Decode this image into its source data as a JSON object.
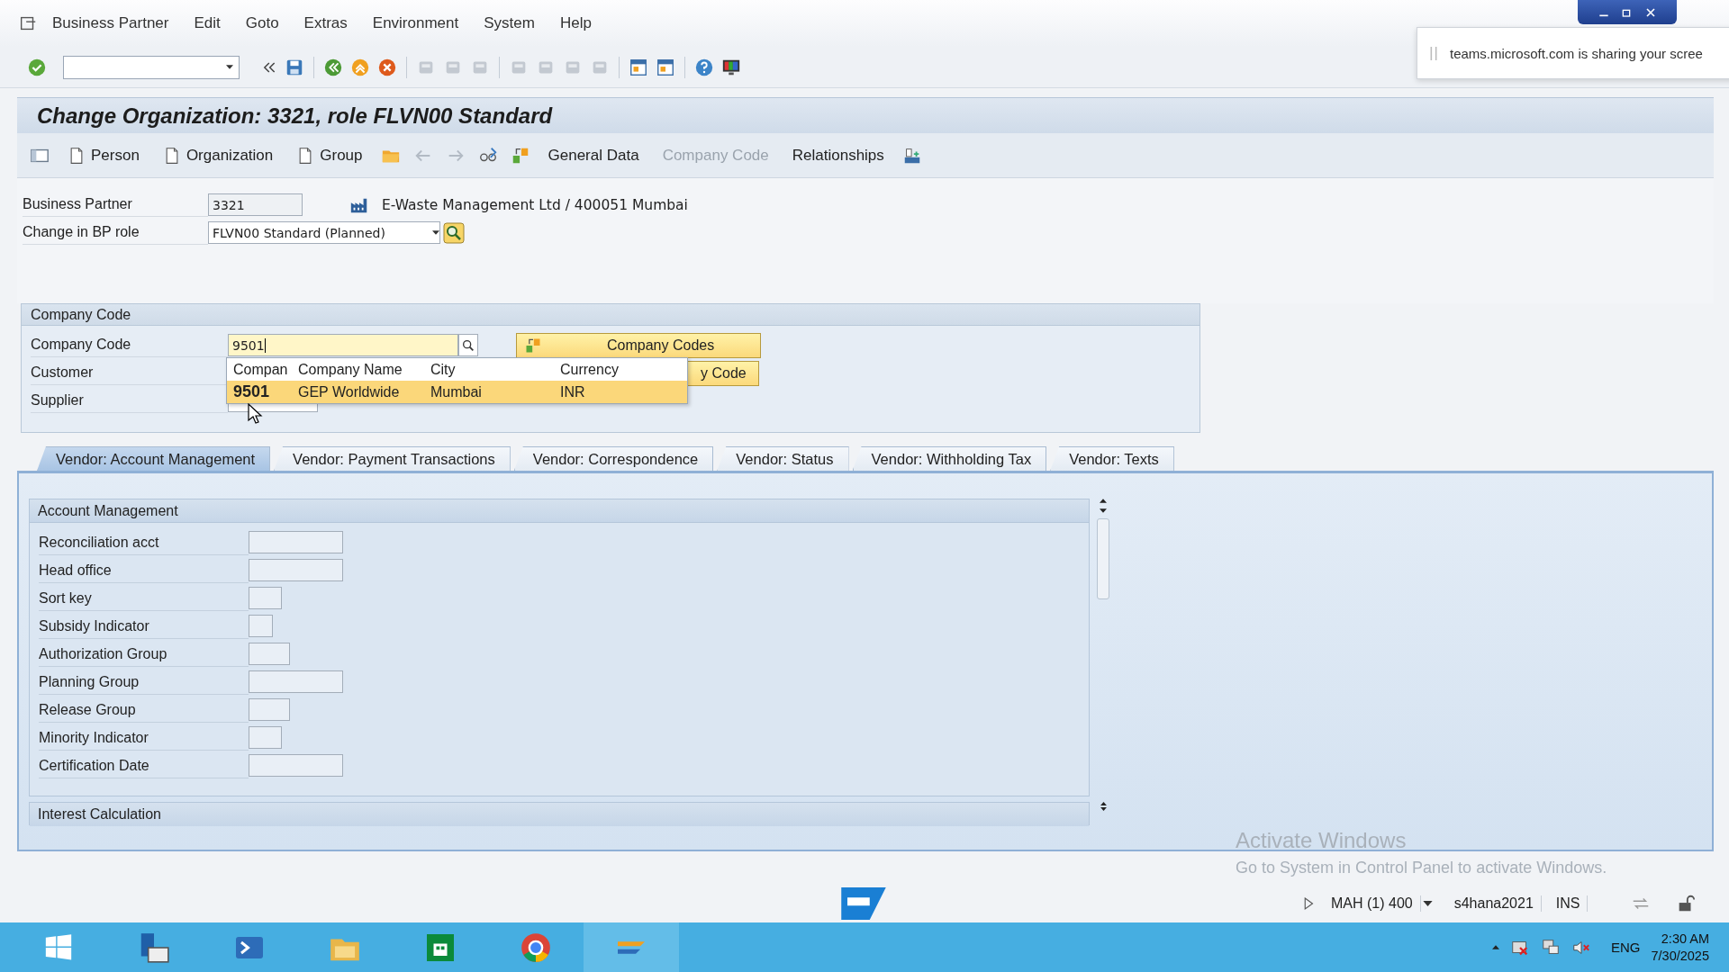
{
  "menu_bar": {
    "items": [
      "Business Partner",
      "Edit",
      "Goto",
      "Extras",
      "Environment",
      "System",
      "Help"
    ]
  },
  "notification": {
    "text": "teams.microsoft.com is sharing your scree"
  },
  "title": "Change Organization: 3321, role FLVN00 Standard",
  "app_toolbar": {
    "buttons": [
      {
        "label": "Person",
        "kind": "page",
        "disabled": false
      },
      {
        "label": "Organization",
        "kind": "page",
        "disabled": false
      },
      {
        "label": "Group",
        "kind": "page",
        "disabled": false
      },
      {
        "label": "General Data",
        "kind": "text",
        "disabled": false
      },
      {
        "label": "Company Code",
        "kind": "text",
        "disabled": true
      },
      {
        "label": "Relationships",
        "kind": "text",
        "disabled": false
      }
    ]
  },
  "header_fields": [
    {
      "kind": "text",
      "label": "Business Partner",
      "value": "3321",
      "description": "E-Waste Management Ltd / 400051 Mumbai"
    },
    {
      "kind": "dropdown",
      "label": "Change in BP role",
      "value": "FLVN00 Standard (Planned)"
    }
  ],
  "company_code_group": {
    "title": "Company Code",
    "fields": [
      {
        "label": "Company Code",
        "value": "9501"
      },
      {
        "label": "Customer"
      },
      {
        "label": "Supplier"
      }
    ],
    "buttons": [
      "Company Codes",
      "y Code"
    ]
  },
  "suggestion_popup": {
    "columns": [
      "Compan",
      "Company Name",
      "City",
      "Currency"
    ],
    "rows": [
      {
        "cells": [
          "9501",
          "GEP Worldwide",
          "Mumbai",
          "INR"
        ],
        "selected": true
      }
    ]
  },
  "tabs": [
    {
      "label": "Vendor: Account Management",
      "selected": true
    },
    {
      "label": "Vendor: Payment Transactions",
      "selected": false
    },
    {
      "label": "Vendor: Correspondence",
      "selected": false
    },
    {
      "label": "Vendor: Status",
      "selected": false
    },
    {
      "label": "Vendor: Withholding Tax",
      "selected": false
    },
    {
      "label": "Vendor: Texts",
      "selected": false
    }
  ],
  "account_management": {
    "title": "Account Management",
    "fields": [
      {
        "label": "Reconciliation acct",
        "kind": "long"
      },
      {
        "label": "Head office",
        "kind": "long"
      },
      {
        "label": "Sort key",
        "kind": "short"
      },
      {
        "label": "Subsidy Indicator",
        "kind": "tiny"
      },
      {
        "label": "Authorization Group",
        "kind": "medium"
      },
      {
        "label": "Planning Group",
        "kind": "long"
      },
      {
        "label": "Release Group",
        "kind": "medium"
      },
      {
        "label": "Minority Indicator",
        "kind": "short"
      },
      {
        "label": "Certification Date",
        "kind": "long"
      }
    ]
  },
  "interest_section": {
    "title": "Interest Calculation"
  },
  "windows_notice": {
    "title": "Activate Windows",
    "text": "Go to System in Control Panel to activate Windows."
  },
  "status_bar": {
    "system": "MAH (1) 400",
    "server": "s4hana2021",
    "mode": "INS"
  },
  "taskbar": {
    "language": "ENG",
    "time": "2:30 AM",
    "date": "7/30/2025"
  }
}
